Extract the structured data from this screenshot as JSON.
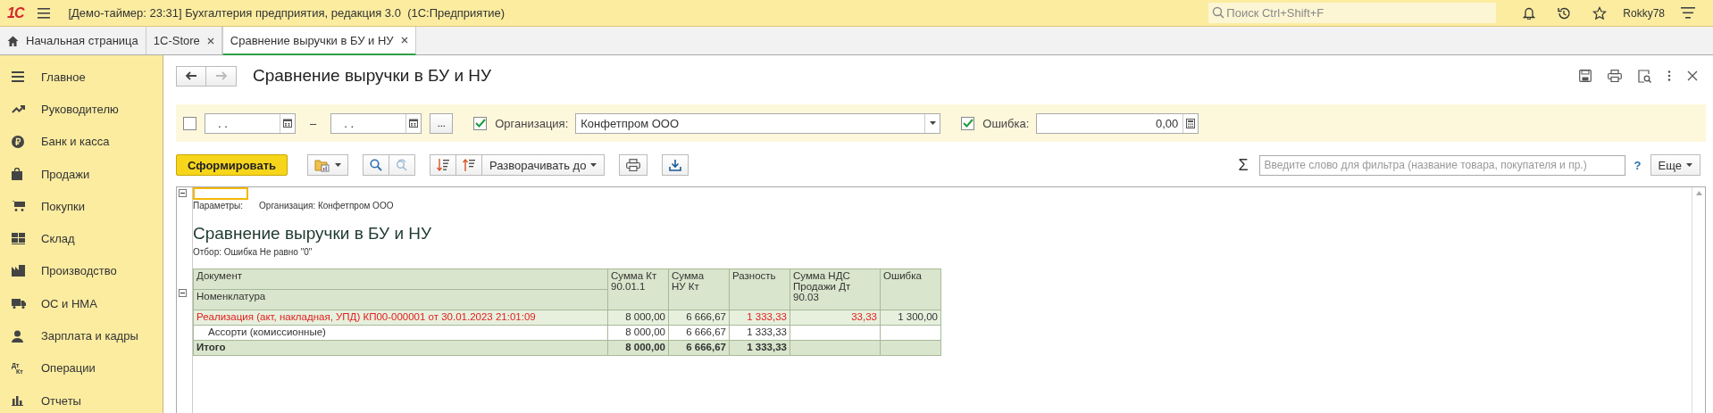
{
  "app_bar": {
    "logo": "1С",
    "title": "[Демо-таймер: 23:31] Бухгалтерия предприятия, редакция 3.0  (1С:Предприятие)",
    "search_placeholder": "Поиск Ctrl+Shift+F",
    "user": "Rokky78"
  },
  "tabs": [
    {
      "label": "Начальная страница",
      "kind": "home",
      "selected": false
    },
    {
      "label": "1C-Store",
      "kind": "doc",
      "selected": false
    },
    {
      "label": "Сравнение выручки в БУ и НУ",
      "kind": "doc",
      "selected": true
    }
  ],
  "sidebar": {
    "items": [
      {
        "label": "Главное"
      },
      {
        "label": "Руководителю"
      },
      {
        "label": "Банк и касса"
      },
      {
        "label": "Продажи"
      },
      {
        "label": "Покупки"
      },
      {
        "label": "Склад"
      },
      {
        "label": "Производство"
      },
      {
        "label": "ОС и НМА"
      },
      {
        "label": "Зарплата и кадры"
      },
      {
        "label": "Операции",
        "icon_label": [
          "Дт",
          "Кт"
        ]
      },
      {
        "label": "Отчеты"
      }
    ]
  },
  "form": {
    "title": "Сравнение выручки в БУ и НУ",
    "filters": {
      "period": {
        "checked": false,
        "from": ". .",
        "dash": "–",
        "to": ". .",
        "more": "..."
      },
      "organization": {
        "checked": true,
        "label": "Организация:",
        "value": "Конфетпром ООО"
      },
      "error": {
        "checked": true,
        "label": "Ошибка:",
        "value": "0,00"
      }
    },
    "toolbar": {
      "generate": "Сформировать",
      "expand": "Разворачивать до",
      "sigma": "Σ",
      "filter_placeholder": "Введите слово для фильтра (название товара, покупателя и пр.)",
      "help": "?",
      "more": "Еще"
    },
    "report": {
      "params_label": "Параметры:",
      "params_value": "Организация: Конфетпром ООО",
      "title": "Сравнение выручки в БУ и НУ",
      "filter": "Отбор: Ошибка Не равно \"0\"",
      "columns": [
        "Документ",
        "Сумма Кт\n90.01.1",
        "Сумма\nНУ Кт",
        "Разность",
        "Сумма НДС\nПродажи Дт\n90.03",
        "Ошибка"
      ],
      "subheader": [
        "Номенклатура"
      ],
      "rows": [
        {
          "kind": "group",
          "cells": [
            {
              "text": "Реализация (акт, накладная, УПД) КП00-000001 от 30.01.2023 21:01:09",
              "alert": true
            },
            {
              "text": "8 000,00",
              "alert": false
            },
            {
              "text": "6 666,67",
              "alert": false
            },
            {
              "text": "1 333,33",
              "alert": true
            },
            {
              "text": "33,33",
              "alert": true
            },
            {
              "text": "1 300,00",
              "alert": false
            }
          ]
        },
        {
          "kind": "detail",
          "cells": [
            {
              "text": "Ассорти (комиссионные)",
              "alert": false
            },
            {
              "text": "8 000,00",
              "alert": false
            },
            {
              "text": "6 666,67",
              "alert": false
            },
            {
              "text": "1 333,33",
              "alert": false
            }
          ]
        },
        {
          "kind": "total",
          "cells": [
            {
              "text": "Итого",
              "alert": false
            },
            {
              "text": "8 000,00",
              "alert": false
            },
            {
              "text": "6 666,67",
              "alert": false
            },
            {
              "text": "1 333,33",
              "alert": false
            }
          ]
        }
      ]
    }
  }
}
